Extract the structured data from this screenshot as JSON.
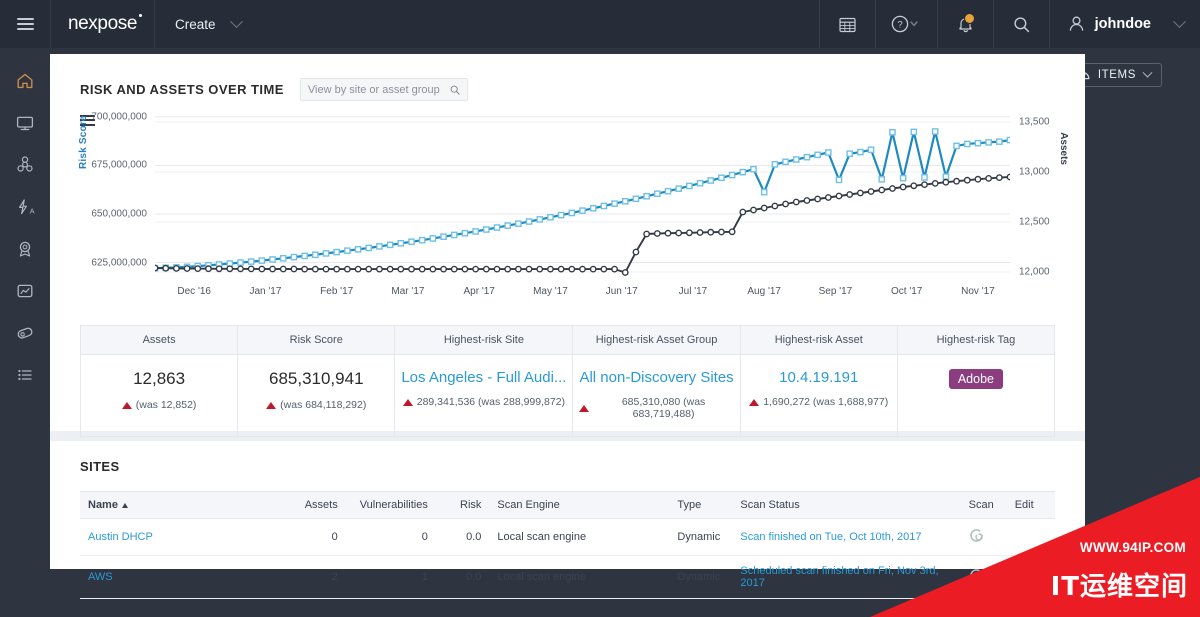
{
  "topbar": {
    "menu_icon": "hamburger-icon",
    "brand": "nexpose",
    "create_label": "Create",
    "icons": [
      "calendar-icon",
      "help-icon",
      "notification-bell-icon",
      "search-icon"
    ],
    "username": "johndoe"
  },
  "sidebar": {
    "items": [
      {
        "name": "home",
        "icon": "home-icon",
        "active": true
      },
      {
        "name": "assets",
        "icon": "monitor-icon",
        "active": false
      },
      {
        "name": "vulnerabilities",
        "icon": "biohazard-icon",
        "active": false
      },
      {
        "name": "exploits",
        "icon": "lightning-a-icon",
        "active": false
      },
      {
        "name": "policies",
        "icon": "award-badge-icon",
        "active": false
      },
      {
        "name": "reports",
        "icon": "chart-box-icon",
        "active": false
      },
      {
        "name": "tickets",
        "icon": "tag-pill-icon",
        "active": false
      },
      {
        "name": "administration",
        "icon": "list-icon",
        "active": false
      }
    ]
  },
  "toolbar": {
    "filter_icon": "filter-funnel-icon",
    "items_label": "ITEMS",
    "items_icon": "cloud-gauge-icon"
  },
  "risk_card": {
    "title": "RISK AND ASSETS OVER TIME",
    "search_placeholder": "View by site or asset group",
    "search_value": "",
    "menu_icon": "chart-menu-icon"
  },
  "chart_data": {
    "type": "line",
    "title": "RISK AND ASSETS OVER TIME",
    "xlabel": "",
    "ylabel": "Risk Score",
    "y2label": "Assets",
    "grid": true,
    "legend": "none",
    "ylim": [
      615000000,
      705000000
    ],
    "y2lim": [
      11900,
      13650
    ],
    "yticks": [
      "625,000,000",
      "650,000,000",
      "675,000,000",
      "700,000,000"
    ],
    "ytick_values": [
      625000000,
      650000000,
      675000000,
      700000000
    ],
    "y2ticks": [
      "12,000",
      "12,500",
      "13,000",
      "13,500"
    ],
    "y2tick_values": [
      12000,
      12500,
      13000,
      13500
    ],
    "xticks": [
      "Dec '16",
      "Jan '17",
      "Feb '17",
      "Mar '17",
      "Apr '17",
      "May '17",
      "Jun '17",
      "Jul '17",
      "Aug '17",
      "Sep '17",
      "Oct '17",
      "Nov '17"
    ],
    "colors": {
      "risk_score": "#1f8ac0",
      "assets": "#333a45"
    },
    "series": [
      {
        "name": "Risk Score",
        "axis": "left",
        "color": "#1f8ac0",
        "marker": "square",
        "values": [
          622100000,
          622300000,
          622500000,
          622800000,
          623200000,
          623600000,
          624000000,
          624500000,
          625000000,
          625500000,
          626000000,
          626600000,
          627200000,
          627800000,
          628400000,
          629000000,
          629700000,
          630400000,
          631100000,
          631800000,
          632500000,
          633300000,
          634100000,
          634900000,
          635700000,
          636500000,
          637400000,
          638300000,
          639200000,
          640100000,
          641000000,
          642000000,
          643000000,
          644000000,
          645000000,
          646100000,
          647200000,
          648300000,
          649400000,
          650500000,
          651700000,
          652900000,
          654100000,
          655300000,
          656500000,
          657800000,
          659100000,
          660400000,
          661700000,
          663000000,
          664400000,
          665800000,
          667200000,
          668600000,
          670000000,
          671500000,
          673000000,
          661200000,
          675500000,
          676800000,
          678000000,
          679200000,
          680400000,
          681600000,
          667500000,
          681000000,
          681800000,
          683000000,
          667800000,
          692000000,
          668400000,
          692200000,
          668800000,
          692400000,
          669200000,
          685000000,
          686000000,
          686400000,
          686800000,
          687200000,
          688000000
        ]
      },
      {
        "name": "Assets",
        "axis": "right",
        "color": "#333a45",
        "marker": "circle",
        "values": [
          12040,
          12038,
          12036,
          12035,
          12034,
          12033,
          12032,
          12032,
          12031,
          12031,
          12030,
          12030,
          12030,
          12030,
          12029,
          12029,
          12029,
          12029,
          12029,
          12029,
          12029,
          12029,
          12029,
          12029,
          12029,
          12029,
          12029,
          12029,
          12029,
          12029,
          12029,
          12029,
          12029,
          12029,
          12029,
          12029,
          12029,
          12029,
          12029,
          12029,
          12029,
          12029,
          12029,
          12029,
          11995,
          12200,
          12380,
          12385,
          12388,
          12390,
          12392,
          12395,
          12398,
          12400,
          12402,
          12600,
          12620,
          12640,
          12660,
          12680,
          12700,
          12715,
          12730,
          12745,
          12760,
          12775,
          12790,
          12805,
          12820,
          12835,
          12850,
          12862,
          12874,
          12886,
          12898,
          12908,
          12918,
          12928,
          12936,
          12944,
          12950
        ]
      }
    ]
  },
  "summary": {
    "columns": [
      {
        "header": "Assets",
        "value": "12,863",
        "value_type": "plain",
        "sub_prefix": "",
        "sub": "(was 12,852)",
        "arrow": "up-red"
      },
      {
        "header": "Risk Score",
        "value": "685,310,941",
        "value_type": "plain",
        "sub_prefix": "",
        "sub": "(was 684,118,292)",
        "arrow": "up-red"
      },
      {
        "header": "Highest-risk Site",
        "value": "Los Angeles - Full Audi...",
        "value_type": "link",
        "sub_prefix": "289,341,536 ",
        "sub": "(was 288,999,872)",
        "arrow": "up-red"
      },
      {
        "header": "Highest-risk Asset Group",
        "value": "All non-Discovery Sites",
        "value_type": "link",
        "sub_prefix": "685,310,080 ",
        "sub": "(was 683,719,488)",
        "arrow": "up-red"
      },
      {
        "header": "Highest-risk Asset",
        "value": "10.4.19.191",
        "value_type": "link",
        "sub_prefix": "1,690,272 ",
        "sub": "(was 1,688,977)",
        "arrow": "up-red"
      },
      {
        "header": "Highest-risk Tag",
        "value": "Adobe",
        "value_type": "tag",
        "sub_prefix": "",
        "sub": "",
        "arrow": "none"
      }
    ]
  },
  "sites_card": {
    "title": "SITES",
    "columns": [
      {
        "label": "Name",
        "align": "left",
        "sorted": true
      },
      {
        "label": "Assets",
        "align": "right",
        "sorted": false
      },
      {
        "label": "Vulnerabilities",
        "align": "right",
        "sorted": false
      },
      {
        "label": "Risk",
        "align": "right",
        "sorted": false
      },
      {
        "label": "Scan Engine",
        "align": "left",
        "sorted": false
      },
      {
        "label": "Type",
        "align": "left",
        "sorted": false
      },
      {
        "label": "Scan Status",
        "align": "left",
        "sorted": false
      },
      {
        "label": "Scan",
        "align": "left",
        "sorted": false
      },
      {
        "label": "Edit",
        "align": "left",
        "sorted": false
      }
    ],
    "rows": [
      {
        "name": "Austin DHCP",
        "assets": "0",
        "vulnerabilities": "0",
        "risk": "0.0",
        "scan_engine": "Local scan engine",
        "type": "Dynamic",
        "scan_status": "Scan finished on Tue, Oct 10th, 2017",
        "scan_icon": "scan-start-icon",
        "edit_icon": "edit-pencil-icon"
      },
      {
        "name": "AWS",
        "assets": "2",
        "vulnerabilities": "1",
        "risk": "0.0",
        "scan_engine": "Local scan engine",
        "type": "Dynamic",
        "scan_status": "Scheduled scan finished on Fri, Nov 3rd, 2017",
        "scan_icon": "scan-start-icon",
        "edit_icon": "edit-pencil-icon"
      }
    ]
  },
  "watermark": {
    "url": "WWW.94IP.COM",
    "text": "IT运维空间",
    "color": "#ec1c24"
  }
}
